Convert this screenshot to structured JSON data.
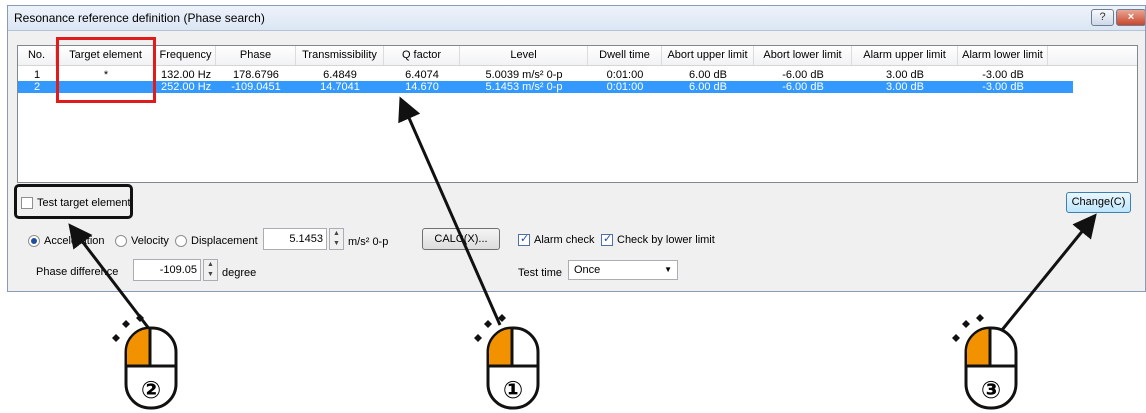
{
  "window": {
    "title": "Resonance reference definition (Phase search)",
    "help_label": "?",
    "close_label": "×"
  },
  "table": {
    "headers": [
      "No.",
      "Target element",
      "Frequency",
      "Phase",
      "Transmissibility",
      "Q factor",
      "Level",
      "Dwell time",
      "Abort upper limit",
      "Abort lower limit",
      "Alarm upper limit",
      "Alarm lower limit"
    ],
    "rows": [
      {
        "no": "1",
        "target": "*",
        "frequency": "132.00 Hz",
        "phase": "178.6796",
        "trans": "6.4849",
        "q": "6.4074",
        "level": "5.0039 m/s² 0-p",
        "dwell": "0:01:00",
        "abort_up": "6.00 dB",
        "abort_low": "-6.00 dB",
        "alarm_up": "3.00 dB",
        "alarm_low": "-3.00 dB",
        "selected": false
      },
      {
        "no": "2",
        "target": "",
        "frequency": "252.00 Hz",
        "phase": "-109.0451",
        "trans": "14.7041",
        "q": "14.670",
        "level": "5.1453 m/s² 0-p",
        "dwell": "0:01:00",
        "abort_up": "6.00 dB",
        "abort_low": "-6.00 dB",
        "alarm_up": "3.00 dB",
        "alarm_low": "-3.00 dB",
        "selected": true
      }
    ]
  },
  "controls": {
    "test_target_label": "Test target element",
    "change_button": "Change(C)",
    "radio_acceleration": "Acceleration",
    "radio_velocity": "Velocity",
    "radio_displacement": "Displacement",
    "level_value": "5.1453",
    "level_unit": "m/s² 0-p",
    "calc_button": "CALC(X)...",
    "alarm_check_label": "Alarm check",
    "check_lower_label": "Check by lower limit",
    "phase_diff_label": "Phase difference",
    "phase_diff_value": "-109.05",
    "phase_diff_unit": "degree",
    "test_time_label": "Test time",
    "test_time_value": "Once"
  },
  "callouts": [
    {
      "marker": "①"
    },
    {
      "marker": "②"
    },
    {
      "marker": "③"
    }
  ],
  "colors": {
    "accent": "#f39200",
    "highlight_red": "#e01b1b",
    "selection": "#3399ff"
  }
}
